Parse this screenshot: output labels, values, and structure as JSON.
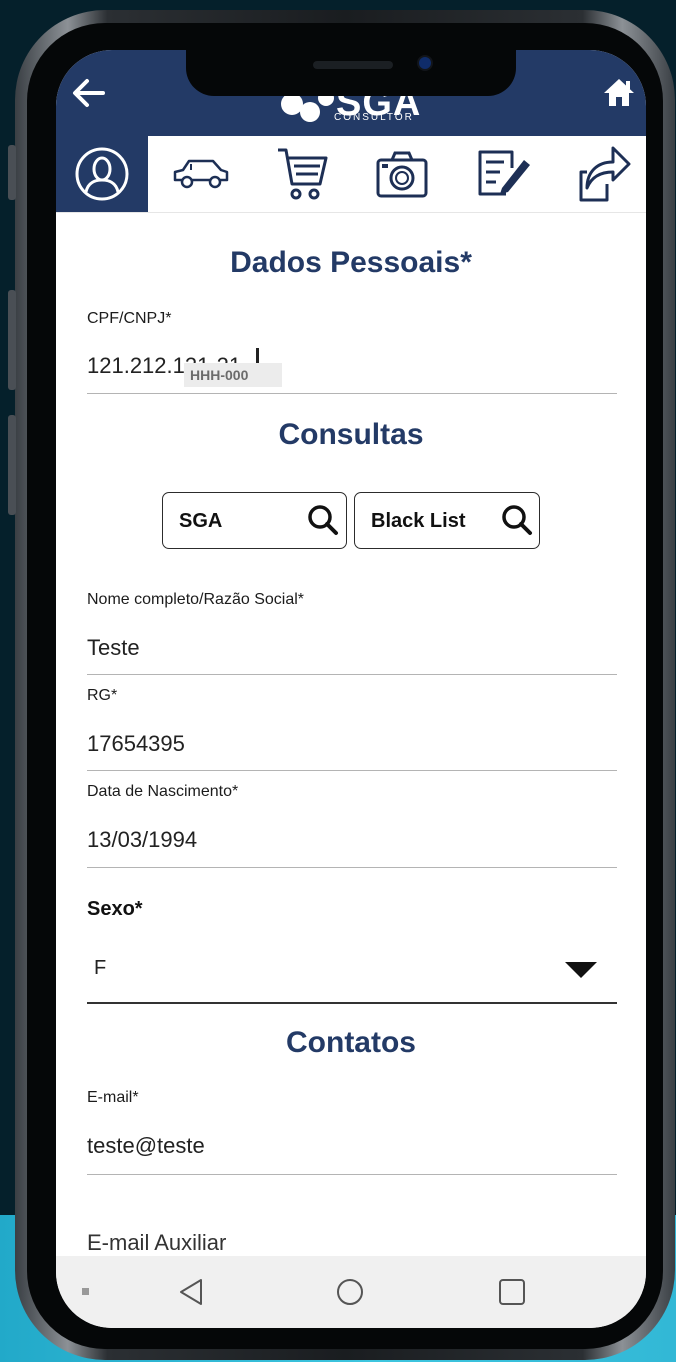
{
  "header": {
    "back_icon": "arrow-left-icon",
    "home_icon": "home-icon",
    "logo_text": "SGA",
    "logo_subtext": "CONSULTOR",
    "bg_color": "#233a66"
  },
  "tabs": [
    {
      "icon": "person-icon",
      "active": true
    },
    {
      "icon": "car-icon",
      "active": false
    },
    {
      "icon": "cart-icon",
      "active": false
    },
    {
      "icon": "camera-icon",
      "active": false
    },
    {
      "icon": "edit-document-icon",
      "active": false
    },
    {
      "icon": "share-icon",
      "active": false
    }
  ],
  "form": {
    "personal_title": "Dados Pessoais*",
    "cpf": {
      "label": "CPF/CNPJ*",
      "value": "121.212.121-21",
      "chip": "HHH-000"
    },
    "consultas_title": "Consultas",
    "buttons": {
      "sga": "SGA",
      "blacklist": "Black List"
    },
    "name": {
      "label": "Nome completo/Razão Social*",
      "value": "Teste"
    },
    "rg": {
      "label": "RG*",
      "value": "17654395"
    },
    "birth": {
      "label": "Data de Nascimento*",
      "value": "13/03/1994"
    },
    "sexo": {
      "label": "Sexo*",
      "value": "F"
    },
    "contatos_title": "Contatos",
    "email": {
      "label": "E-mail*",
      "value": "teste@teste"
    },
    "email_aux": {
      "placeholder": "E-mail Auxiliar"
    }
  },
  "navbar": {
    "icons": [
      "menu-dot-icon",
      "back-triangle-icon",
      "home-circle-icon",
      "recents-square-icon"
    ]
  },
  "colors": {
    "brand": "#233a66",
    "background": "#05202b",
    "accent": "#32b8d6"
  }
}
